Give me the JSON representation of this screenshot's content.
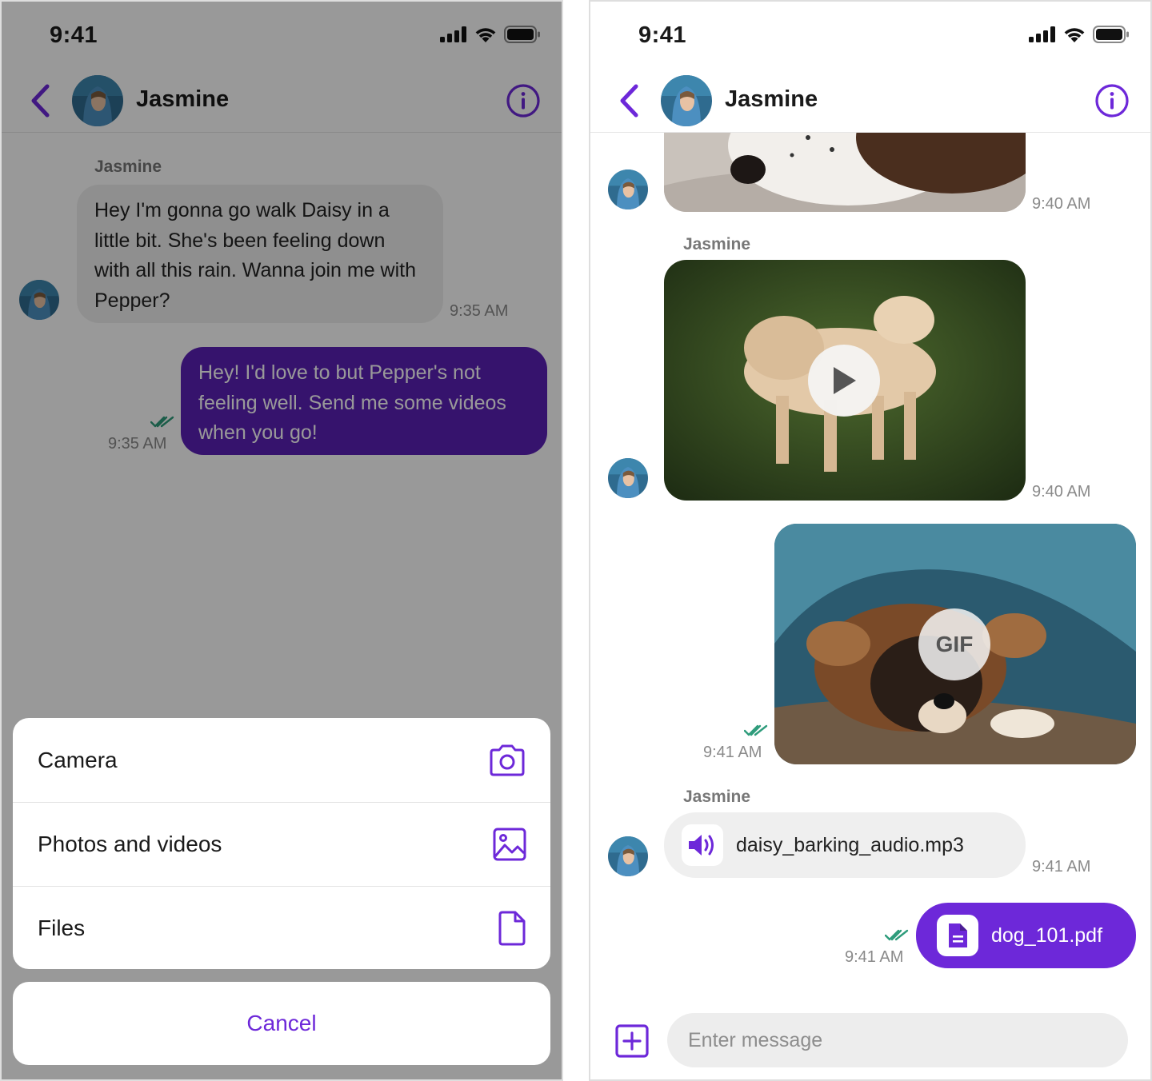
{
  "colors": {
    "accent": "#6d28d9",
    "accent_dark": "#5b21b6",
    "read_check": "#2e9c7b",
    "incoming_bubble": "#efefef"
  },
  "left_screen": {
    "status": {
      "time": "9:41",
      "icons": [
        "signal-icon",
        "wifi-icon",
        "battery-icon"
      ]
    },
    "header": {
      "contact_name": "Jasmine"
    },
    "messages": [
      {
        "sender": "Jasmine",
        "text": "Hey I'm gonna go walk Daisy in a little bit. She's been feeling down with all this rain. Wanna join me with Pepper?",
        "time": "9:35 AM"
      },
      {
        "text": "Hey! I'd love to but Pepper's not feeling well. Send me some videos when you go!",
        "time": "9:35 AM"
      }
    ],
    "action_sheet": {
      "items": [
        {
          "label": "Camera",
          "icon": "camera-icon"
        },
        {
          "label": "Photos and videos",
          "icon": "image-icon"
        },
        {
          "label": "Files",
          "icon": "file-icon"
        }
      ],
      "cancel_label": "Cancel"
    }
  },
  "right_screen": {
    "status": {
      "time": "9:41",
      "icons": [
        "signal-icon",
        "wifi-icon",
        "battery-icon"
      ]
    },
    "header": {
      "contact_name": "Jasmine"
    },
    "messages": [
      {
        "type": "image",
        "time": "9:40 AM"
      },
      {
        "type": "video",
        "sender": "Jasmine",
        "time": "9:40 AM"
      },
      {
        "type": "gif",
        "badge": "GIF",
        "time": "9:41 AM"
      },
      {
        "type": "audio",
        "sender": "Jasmine",
        "filename": "daisy_barking_audio.mp3",
        "time": "9:41 AM"
      },
      {
        "type": "file",
        "filename": "dog_101.pdf",
        "time": "9:41 AM"
      }
    ],
    "composer": {
      "placeholder": "Enter message"
    }
  }
}
